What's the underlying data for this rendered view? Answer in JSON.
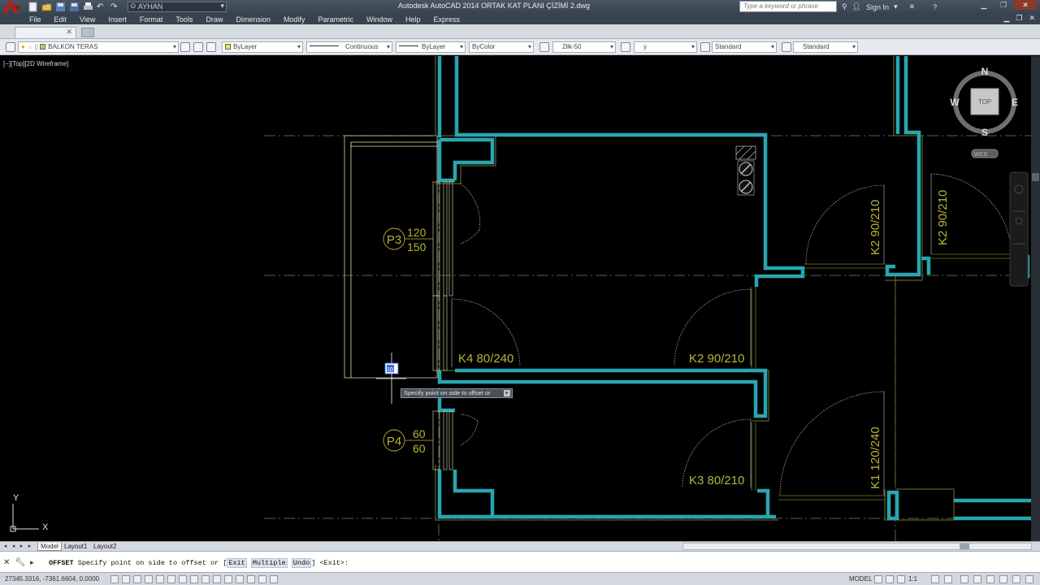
{
  "window": {
    "title": "Autodesk AutoCAD 2014    ORTAK KAT PLANI ÇİZİMİ 2.dwg",
    "workspace": "AYHAN",
    "search_placeholder": "Type a keyword or phrase",
    "sign_in": "Sign In"
  },
  "menu": [
    "File",
    "Edit",
    "View",
    "Insert",
    "Format",
    "Tools",
    "Draw",
    "Dimension",
    "Modify",
    "Parametric",
    "Window",
    "Help",
    "Express"
  ],
  "properties_toolbar": {
    "layer": "BALKON TERAS",
    "color": "ByLayer",
    "linetype": "Continuous",
    "lineweight": "ByLayer",
    "plotstyle": "ByColor",
    "text_style": "2lik-50",
    "dim_style": "y",
    "table_style": "Standard",
    "multileader_style": "Standard"
  },
  "viewport": {
    "label": "[−][Top][2D Wireframe]"
  },
  "viewcube": {
    "north": "N",
    "south": "S",
    "east": "E",
    "west": "W",
    "face": "TOP",
    "ucs": "WCS"
  },
  "drawing_labels": {
    "p3_tag": "P3",
    "p3_top": "120",
    "p3_bottom": "150",
    "p4_tag": "P4",
    "p4_top": "60",
    "p4_bottom": "60",
    "door_k4": "K4 80/240",
    "door_k2_mid": "K2 90/210",
    "door_k3": "K3 80/210",
    "door_k2_right1": "K2 90/210",
    "door_k2_right2": "K2 90/210",
    "door_k1": "K1 120/240",
    "dyn_input": "10"
  },
  "ucs_icon": {
    "x": "X",
    "y": "Y"
  },
  "tooltip": {
    "text": "Specify point on side to offset or"
  },
  "layout_tabs": [
    "Model",
    "Layout1",
    "Layout2"
  ],
  "command": {
    "keyword": "OFFSET",
    "prompt": "Specify point on side to offset or [",
    "opt_exit": "Exit",
    "opt_multiple": "Multiple",
    "opt_undo": "Undo",
    "suffix": "] <Exit>:"
  },
  "status": {
    "coords": "27345.3316, -7361.6604, 0.0000",
    "model": "MODEL",
    "scale": "1:1"
  },
  "colors": {
    "wall_cyan": "#27a6b1",
    "wall_olive": "#6d7d2e",
    "text_yellow": "#b8b43a",
    "background": "#000000"
  }
}
